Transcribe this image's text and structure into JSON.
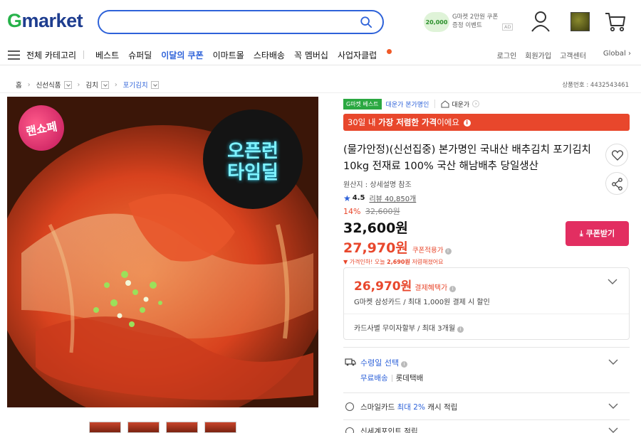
{
  "header": {
    "logo_g": "G",
    "logo_rest": "market",
    "search": {
      "value": "",
      "placeholder": ""
    },
    "promo": {
      "coin_amount": "20,000",
      "text_line1": "G마켓 2만원 쿠폰",
      "text_line2": "증정 이벤트",
      "ad_badge": "AD"
    },
    "icons": [
      "mypage-icon",
      "recent-product-thumbnail",
      "cart-icon"
    ]
  },
  "nav": {
    "all_categories": "전체 카테고리",
    "items": [
      {
        "label": "베스트",
        "highlight": false
      },
      {
        "label": "슈퍼딜",
        "highlight": false
      },
      {
        "label": "이달의 쿠폰",
        "highlight": true
      },
      {
        "label": "이마트몰",
        "highlight": false
      },
      {
        "label": "스타배송",
        "highlight": false
      },
      {
        "label": "꼭 멤버십",
        "highlight": false
      },
      {
        "label": "사업자클럽",
        "highlight": false
      }
    ],
    "right": [
      "로그인",
      "회원가입",
      "고객센터",
      "Global"
    ]
  },
  "breadcrumb": {
    "home": "홈",
    "level1": "신선식품",
    "level2": "김치",
    "level3": "포기김치",
    "product_no": "상품번호 : 4432543461"
  },
  "image": {
    "badge_left": "랜쇼페",
    "badge_right_line1": "오픈런",
    "badge_right_line2": "타임딜"
  },
  "product": {
    "tag_best": "G마켓 베스트",
    "tag_shop": "대운가 본가명인",
    "seller": "대운가",
    "lowest_pre": "30일 내 ",
    "lowest_bold": "가장 저렴한 가격",
    "lowest_post": "이에요",
    "title": "(물가안정)(신선집중) 본가명인 국내산 배추김치 포기김치 10kg 전재료 100% 국산 해남배추 당일생산",
    "origin": "원산지 : 상세설명 참조",
    "rating": "4.5",
    "reviews": "리뷰 40,850개",
    "discount_pct": "14%",
    "original_price": "32,600원",
    "price": "32,600원",
    "coupon_price": "27,970원",
    "coupon_label": "쿠폰적용가",
    "price_drop_pre": "가격인하! 오늘 ",
    "price_drop_amount": "2,690원",
    "price_drop_post": " 저렴해졌어요",
    "coupon_button": "쿠폰받기"
  },
  "card_benefit": {
    "cash_price": "26,970원",
    "cash_label": "결제혜택가",
    "line1": "G마켓 삼성카드 / 최대 1,000원 결제 시 할인",
    "line2": "카드사별 무이자할부 / 최대 3개월"
  },
  "delivery": {
    "title": "수령일 선택",
    "free": "무료배송",
    "carrier": "롯데택배"
  },
  "smile": {
    "pre": "스마일카드 ",
    "bold": "최대 2%",
    "post": " 캐시 적립"
  },
  "points": {
    "label": "신세계포인트 적립"
  },
  "colors": {
    "accent_blue": "#2e62d9",
    "accent_red": "#e8472c",
    "coupon_pink": "#e22e61",
    "best_green": "#2ba841"
  }
}
